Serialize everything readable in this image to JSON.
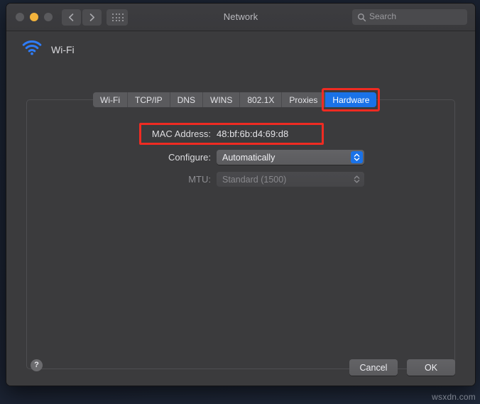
{
  "window": {
    "title": "Network",
    "traffic_lights": [
      {
        "name": "close",
        "color": "#5a5a5d"
      },
      {
        "name": "minimize",
        "color": "#f2b33c"
      },
      {
        "name": "maximize",
        "color": "#5a5a5d"
      }
    ],
    "nav_back_icon": "chevron-left-icon",
    "nav_forward_icon": "chevron-right-icon",
    "grid_icon": "all-preferences-grid-icon"
  },
  "search": {
    "placeholder": "Search",
    "icon": "search-icon"
  },
  "service": {
    "name": "Wi-Fi",
    "icon": "wifi-icon",
    "icon_color": "#2f7cf6"
  },
  "tabs": [
    {
      "label": "Wi-Fi",
      "selected": false
    },
    {
      "label": "TCP/IP",
      "selected": false
    },
    {
      "label": "DNS",
      "selected": false
    },
    {
      "label": "WINS",
      "selected": false
    },
    {
      "label": "802.1X",
      "selected": false
    },
    {
      "label": "Proxies",
      "selected": false
    },
    {
      "label": "Hardware",
      "selected": true
    }
  ],
  "hardware": {
    "mac_label": "MAC Address:",
    "mac_value": "48:bf:6b:d4:69:d8",
    "configure_label": "Configure:",
    "configure_value": "Automatically",
    "mtu_label": "MTU:",
    "mtu_value": "Standard (1500)",
    "mtu_disabled": true
  },
  "footer": {
    "help_label": "?",
    "cancel_label": "Cancel",
    "ok_label": "OK"
  },
  "annotations": {
    "highlight_color": "#ef2b22",
    "accent_color": "#1a72e8"
  },
  "watermark": "wsxdn.com"
}
